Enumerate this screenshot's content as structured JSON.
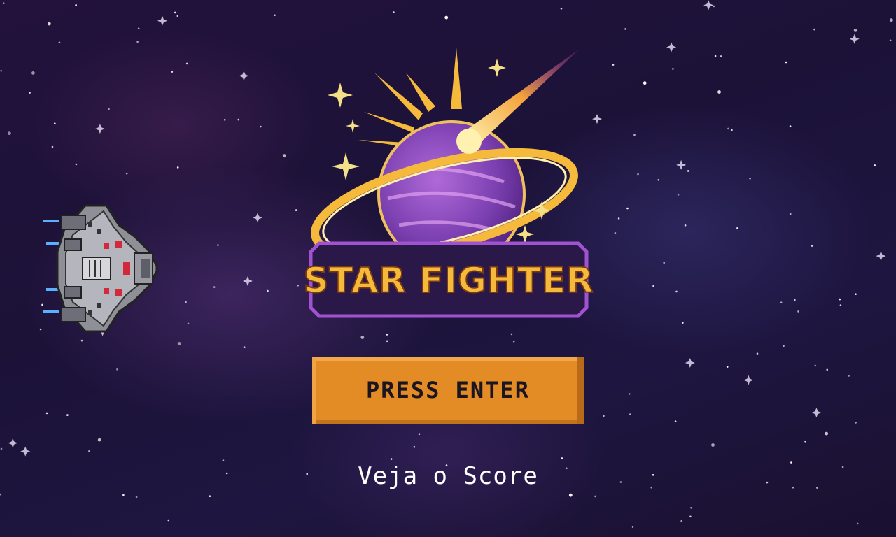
{
  "game": {
    "title": "STAR FIGHTER",
    "press_enter_label": "PRESS ENTER",
    "score_label": "Veja o Score"
  },
  "colors": {
    "background": "#1e1438",
    "button": "#e38c26",
    "logo_gold": "#f5b93c",
    "logo_purple": "#7b3fb0"
  },
  "icons": {
    "player_ship": "spaceship-icon",
    "logo": "ringed-planet-comet-logo"
  }
}
